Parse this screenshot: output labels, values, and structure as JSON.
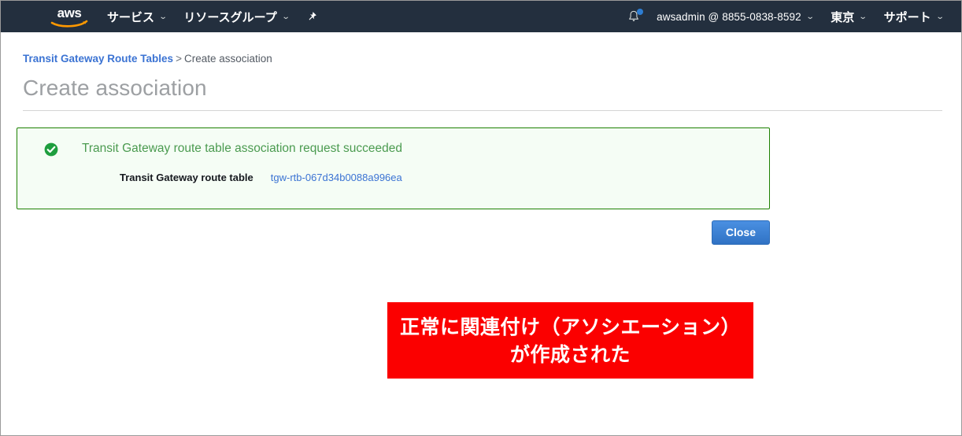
{
  "navbar": {
    "logo_alt": "aws",
    "services_label": "サービス",
    "resource_groups_label": "リソースグループ",
    "pin_icon": "pushpin-icon",
    "bell_icon": "bell-icon",
    "account_label": "awsadmin @ 8855-0838-8592",
    "region_label": "東京",
    "support_label": "サポート",
    "caret": "⌄",
    "background_color": "#232f3e",
    "badge_color": "#2d7dd2"
  },
  "breadcrumb": {
    "link_label": "Transit Gateway Route Tables",
    "separator": ">",
    "current_label": "Create association"
  },
  "page": {
    "title": "Create association"
  },
  "alert": {
    "icon": "success-check-circle-icon",
    "title": "Transit Gateway route table association request succeeded",
    "detail_label": "Transit Gateway route table",
    "detail_value": "tgw-rtb-067d34b0088a996ea",
    "border_color": "#1d8102",
    "background_color": "#f5fdf5",
    "title_color": "#4b9b50"
  },
  "actions": {
    "close_label": "Close",
    "close_color": "#3072c4"
  },
  "annotation": {
    "line1": "正常に関連付け（アソシエーション）",
    "line2": "が作成された",
    "background_color": "#fb0000",
    "text_color": "#ffffff"
  }
}
